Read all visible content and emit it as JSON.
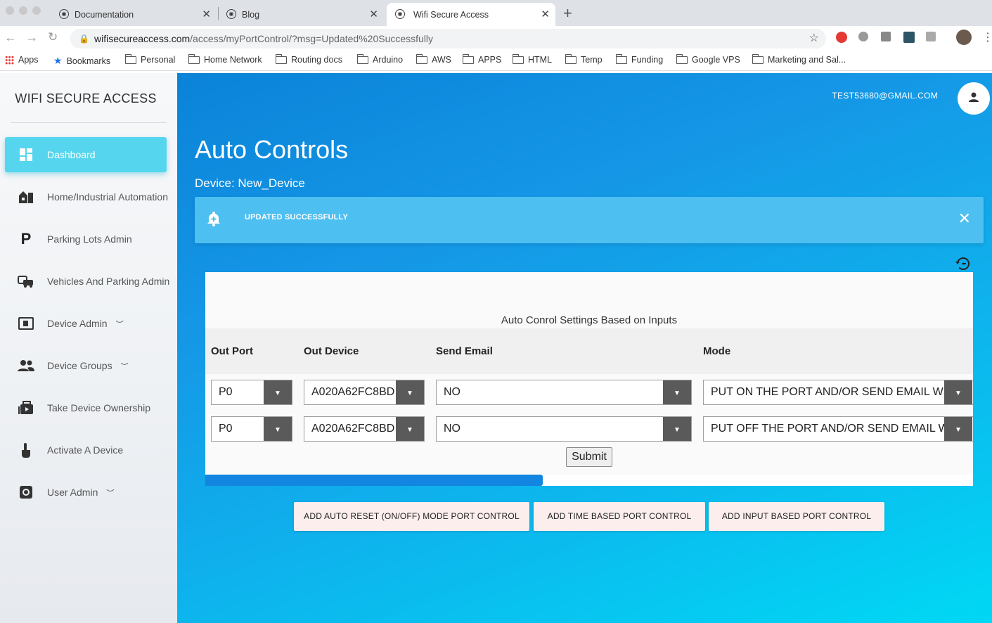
{
  "browser": {
    "tabs": [
      {
        "title": "Documentation"
      },
      {
        "title": "Blog"
      },
      {
        "title": "Wifi Secure Access"
      }
    ],
    "url": "wifisecureaccess.com/access/myPortControl/?msg=Updated%20Successfully",
    "url_host": "wifisecureaccess.com",
    "url_path": "/access/myPortControl/?msg=Updated%20Successfully",
    "bookmarks": [
      "Apps",
      "Bookmarks",
      "Personal",
      "Home Network",
      "Routing docs",
      "Arduino",
      "AWS",
      "APPS",
      "HTML",
      "Temp",
      "Funding",
      "Google VPS",
      "Marketing and Sal..."
    ]
  },
  "sidebar": {
    "brand": "WIFI SECURE ACCESS",
    "items": [
      {
        "label": "Dashboard",
        "icon": "dashboard-icon"
      },
      {
        "label": "Home/Industrial Automation",
        "icon": "factory-icon"
      },
      {
        "label": "Parking Lots Admin",
        "icon": "parking-icon"
      },
      {
        "label": "Vehicles And Parking Admin",
        "icon": "vehicle-icon"
      },
      {
        "label": "Device Admin",
        "icon": "device-icon"
      },
      {
        "label": "Device Groups",
        "icon": "group-icon"
      },
      {
        "label": "Take Device Ownership",
        "icon": "ownership-icon"
      },
      {
        "label": "Activate A Device",
        "icon": "touch-icon"
      },
      {
        "label": "User Admin",
        "icon": "settings-icon"
      }
    ]
  },
  "header": {
    "user_email": "TEST53680@GMAIL.COM"
  },
  "page": {
    "title": "Auto Controls",
    "device": "Device: New_Device",
    "alert": "UPDATED SUCCESSFULLY",
    "card_title": "Auto Conrol Settings Based on Inputs",
    "columns": [
      "Out Port",
      "Out Device",
      "Send Email",
      "Mode"
    ],
    "rows": [
      {
        "port": "P0",
        "device": "A020A62FC8BD",
        "email": "NO",
        "mode": "PUT ON THE PORT AND/OR SEND EMAIL WHEN"
      },
      {
        "port": "P0",
        "device": "A020A62FC8BD",
        "email": "NO",
        "mode": "PUT OFF THE PORT AND/OR SEND EMAIL WHEN"
      }
    ],
    "submit": "Submit",
    "progress": 0.44,
    "buttons": [
      "ADD AUTO RESET (ON/OFF) MODE PORT CONTROL",
      "ADD TIME BASED PORT CONTROL",
      "ADD INPUT BASED PORT CONTROL"
    ]
  },
  "colors": {
    "accent": "#55d6ee",
    "main_bg_start": "#0a83d8",
    "main_bg_end": "#00d8f4",
    "alert": "#4ebff1",
    "progress": "#1286e0"
  }
}
